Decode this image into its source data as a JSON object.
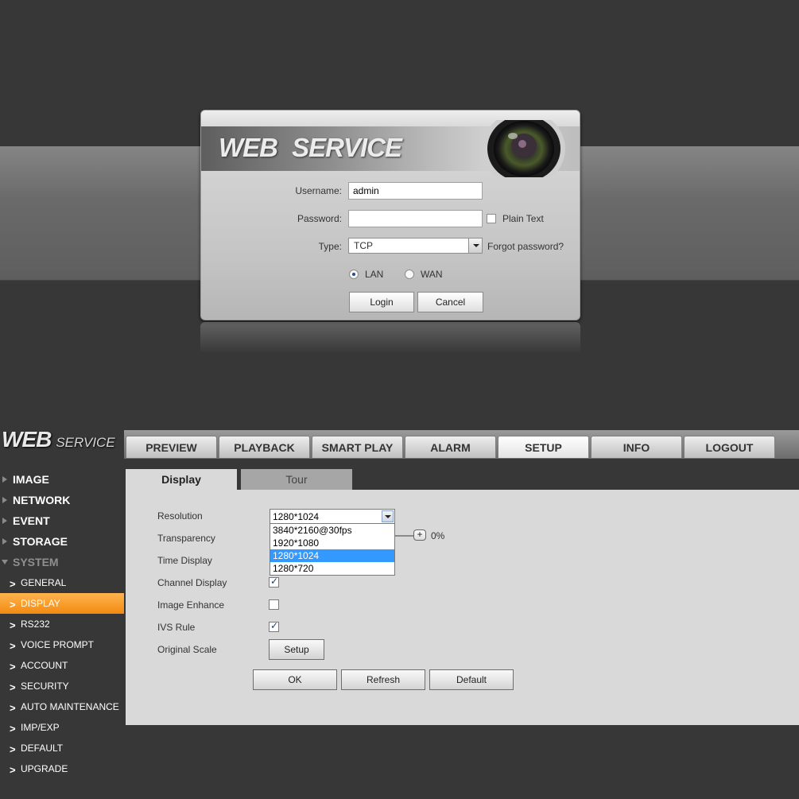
{
  "login": {
    "title": "WEB  SERVICE",
    "username_label": "Username:",
    "username_value": "admin",
    "password_label": "Password:",
    "password_value": "",
    "plain_text_label": "Plain Text",
    "plain_text_checked": false,
    "type_label": "Type:",
    "type_value": "TCP",
    "forgot_password": "Forgot password?",
    "lan_label": "LAN",
    "wan_label": "WAN",
    "selected_network": "LAN",
    "login_button": "Login",
    "cancel_button": "Cancel"
  },
  "setup": {
    "brand": "WEB",
    "brand_sub": "SERVICE",
    "nav_tabs": [
      {
        "label": "PREVIEW"
      },
      {
        "label": "PLAYBACK"
      },
      {
        "label": "SMART PLAY"
      },
      {
        "label": "ALARM"
      },
      {
        "label": "SETUP"
      },
      {
        "label": "INFO"
      },
      {
        "label": "LOGOUT"
      }
    ],
    "active_nav": "SETUP",
    "sidebar": {
      "sections": [
        {
          "label": "IMAGE"
        },
        {
          "label": "NETWORK"
        },
        {
          "label": "EVENT"
        },
        {
          "label": "STORAGE"
        },
        {
          "label": "SYSTEM"
        }
      ],
      "system_items": [
        {
          "label": "GENERAL"
        },
        {
          "label": "DISPLAY"
        },
        {
          "label": "RS232"
        },
        {
          "label": "VOICE PROMPT"
        },
        {
          "label": "ACCOUNT"
        },
        {
          "label": "SECURITY"
        },
        {
          "label": "AUTO MAINTENANCE"
        },
        {
          "label": "IMP/EXP"
        },
        {
          "label": "DEFAULT"
        },
        {
          "label": "UPGRADE"
        }
      ],
      "active_item": "DISPLAY"
    },
    "content_tabs": [
      {
        "label": "Display"
      },
      {
        "label": "Tour"
      }
    ],
    "fields": {
      "resolution_label": "Resolution",
      "resolution_value": "1280*1024",
      "resolution_options": [
        "3840*2160@30fps",
        "1920*1080",
        "1280*1024",
        "1280*720"
      ],
      "transparency_label": "Transparency",
      "transparency_value": "0%",
      "time_display_label": "Time Display",
      "channel_display_label": "Channel Display",
      "channel_display_checked": true,
      "image_enhance_label": "Image Enhance",
      "image_enhance_checked": false,
      "ivs_rule_label": "IVS Rule",
      "ivs_rule_checked": true,
      "original_scale_label": "Original Scale",
      "setup_button": "Setup"
    },
    "buttons": {
      "ok": "OK",
      "refresh": "Refresh",
      "default": "Default"
    }
  }
}
